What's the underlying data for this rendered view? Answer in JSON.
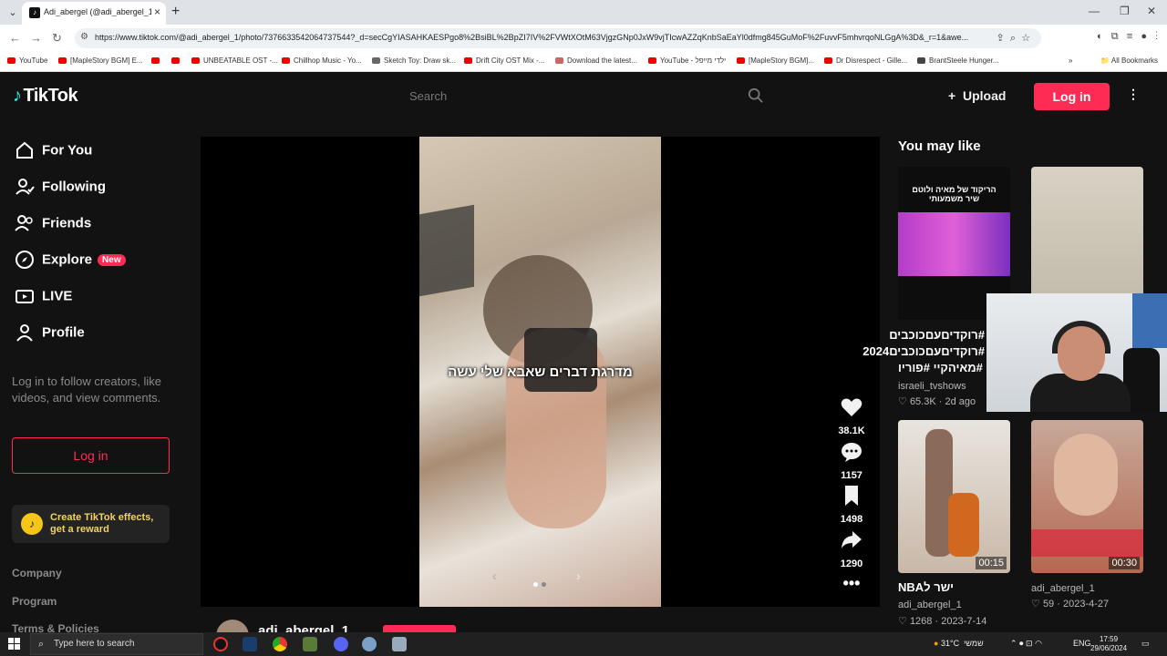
{
  "browser": {
    "tab_title": "Adi_abergel (@adi_abergel_1) |",
    "url": "https://www.tiktok.com/@adi_abergel_1/photo/7376633542064737544?_d=secCgYIASAHKAESPgo8%2BsiBL%2BpZI7IV%2FVWtXOtM63VjgzGNp0JxW9vjTIcwAZZqKnbSaEaYl0dfmg845GuMoF%2FuvvF5mhvrqoNLGgA%3D&_r=1&awe...",
    "bookmarks": [
      "YouTube",
      "[MapleStory BGM] E...",
      "",
      "",
      "UNBEATABLE OST -...",
      "Chillhop Music - Yo...",
      "Sketch Toy: Draw sk...",
      "Drift City OST Mix -...",
      "Download the latest...",
      "YouTube - ילדי מייפל",
      "[MapleStory BGM]...",
      "Dr Disrespect - Gille...",
      "BrantSteele Hunger..."
    ],
    "all_bookmarks": "All Bookmarks"
  },
  "header": {
    "logo": "TikTok",
    "search_placeholder": "Search",
    "upload_label": "Upload",
    "login_label": "Log in"
  },
  "sidebar": {
    "items": [
      {
        "label": "For You",
        "icon": "home-icon"
      },
      {
        "label": "Following",
        "icon": "following-icon"
      },
      {
        "label": "Friends",
        "icon": "friends-icon"
      },
      {
        "label": "Explore",
        "icon": "compass-icon",
        "badge": "New"
      },
      {
        "label": "LIVE",
        "icon": "live-icon"
      },
      {
        "label": "Profile",
        "icon": "profile-icon"
      }
    ],
    "login_prompt": "Log in to follow creators, like videos, and view comments.",
    "login_button": "Log in",
    "effects_line1": "Create TikTok effects,",
    "effects_line2": "get a reward",
    "footer_links": [
      "Company",
      "Program",
      "Terms & Policies"
    ]
  },
  "post": {
    "caption": "מדרגת דברים שאבא שלי עשה",
    "likes": "38.1K",
    "comments": "1157",
    "saves": "1498",
    "shares": "1290",
    "author": "adi_abergel_1",
    "accent": "#fe2c55"
  },
  "recommendations": {
    "title": "You may like",
    "items": [
      {
        "text": "#רוקדיםעםכוכבים #רוקדיםעםכוכבים2024 #מאיהקיי #פוריו",
        "author": "israeli_tvshows",
        "likes": "65.3K",
        "date": "2d ago",
        "duration": ""
      },
      {
        "text": "",
        "author": "",
        "likes": "",
        "date": "",
        "duration": ""
      },
      {
        "text": "ישר לNBA",
        "author": "adi_abergel_1",
        "likes": "1268",
        "date": "2023-7-14",
        "duration": "00:15"
      },
      {
        "text": "",
        "author": "adi_abergel_1",
        "likes": "59",
        "date": "2023-4-27",
        "duration": "00:30"
      }
    ],
    "thumb1_overlay": "הריקוד של מאיה ולוטם שיר משמעותי"
  },
  "taskbar": {
    "search_placeholder": "Type here to search",
    "weather": "31°C",
    "weather_day": "שמשי",
    "lang": "ENG",
    "time": "17:59",
    "date": "29/06/2024"
  }
}
